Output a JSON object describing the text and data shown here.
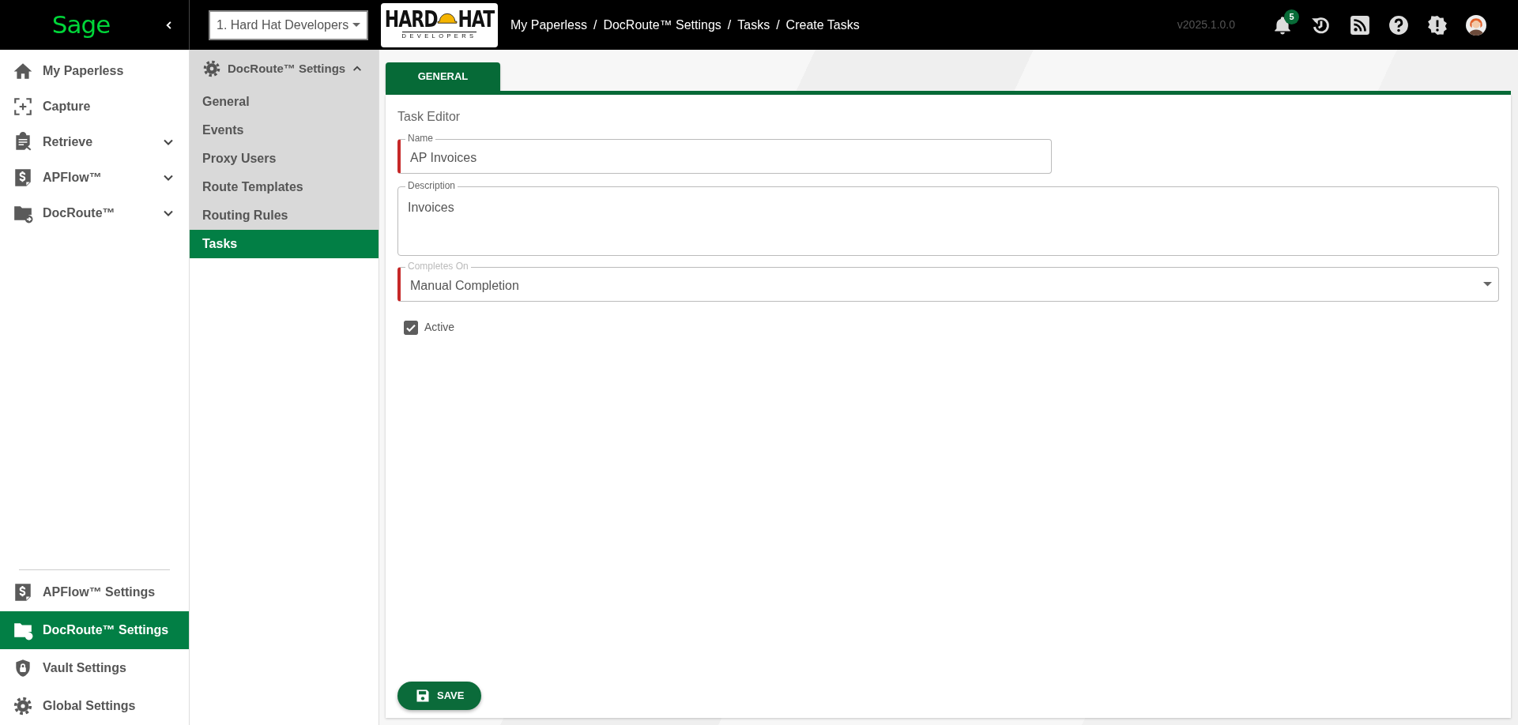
{
  "topbar": {
    "logo": "Sage",
    "company_select": {
      "value": "1. Hard Hat Developers"
    },
    "brand": {
      "words": [
        "HARD",
        "HAT"
      ],
      "subtitle": "DEVELOPERS"
    },
    "breadcrumbs": [
      {
        "label": "My Paperless"
      },
      {
        "label": "DocRoute™ Settings"
      },
      {
        "label": "Tasks"
      },
      {
        "label": "Create Tasks"
      }
    ],
    "separators": [
      "/",
      "/",
      "/"
    ],
    "version": "v2025.1.0.0",
    "notifications_badge": "5"
  },
  "sidebar": {
    "items": [
      {
        "label": "My Paperless",
        "selected": false
      },
      {
        "label": "Capture",
        "selected": false
      },
      {
        "label": "Retrieve",
        "selected": false,
        "expanded": false
      },
      {
        "label": "APFlow™",
        "selected": false,
        "expanded": false
      },
      {
        "label": "DocRoute™",
        "selected": false,
        "expanded": false
      }
    ],
    "bottom_items": [
      {
        "label": "APFlow™ Settings",
        "selected": false
      },
      {
        "label": "DocRoute™ Settings",
        "selected": true
      },
      {
        "label": "Vault Settings",
        "selected": false
      },
      {
        "label": "Global Settings",
        "selected": false
      }
    ]
  },
  "submenu": {
    "title": "DocRoute™ Settings",
    "expanded": true,
    "items": [
      {
        "label": "General",
        "selected": false
      },
      {
        "label": "Events",
        "selected": false
      },
      {
        "label": "Proxy Users",
        "selected": false
      },
      {
        "label": "Route Templates",
        "selected": false
      },
      {
        "label": "Routing Rules",
        "selected": false
      },
      {
        "label": "Tasks",
        "selected": true
      }
    ]
  },
  "tabs": [
    {
      "label": "GENERAL",
      "selected": true
    }
  ],
  "form": {
    "title": "Task Editor",
    "fields": [
      {
        "kind": "text",
        "label": "Name",
        "value": "AP Invoices",
        "required": true
      },
      {
        "kind": "textarea",
        "label": "Description",
        "value": "Invoices",
        "required": false
      },
      {
        "kind": "select",
        "label": "Completes On",
        "value": "Manual Completion",
        "required": true
      }
    ],
    "checkbox": {
      "label": "Active",
      "checked": true
    },
    "save_button": "SAVE"
  }
}
